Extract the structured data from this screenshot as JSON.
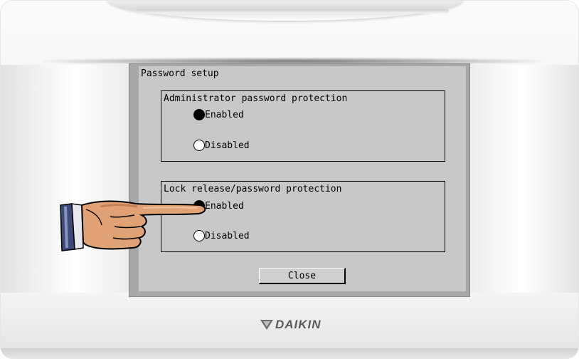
{
  "dialog": {
    "title": "Password setup",
    "admin_group": {
      "title": "Administrator password protection",
      "options": [
        {
          "label": "Enabled",
          "selected": true
        },
        {
          "label": "Disabled",
          "selected": false
        }
      ]
    },
    "lock_group": {
      "title": "Lock release/password protection",
      "options": [
        {
          "label": "Enabled",
          "selected": true
        },
        {
          "label": "Disabled",
          "selected": false
        }
      ]
    },
    "close_label": "Close"
  },
  "device": {
    "brand": "DAIKIN",
    "brand_color": "#5b5b5b"
  },
  "annotation": {
    "icon": "pointing-hand-icon",
    "points_to": "lock_group.options.0"
  }
}
